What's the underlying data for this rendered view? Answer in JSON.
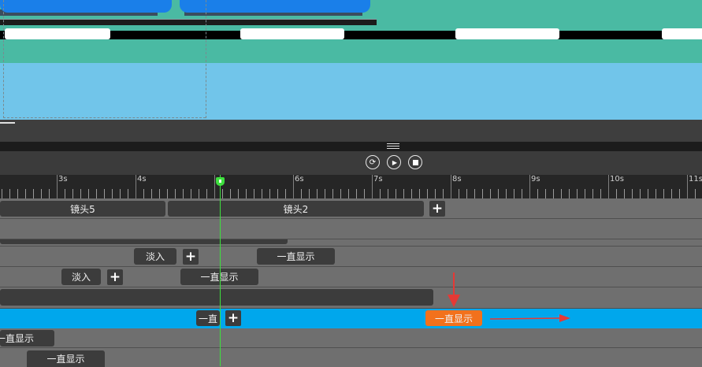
{
  "ruler": {
    "ticks": [
      "3s",
      "4s",
      "5s",
      "6s",
      "7s",
      "8s",
      "9s",
      "10s",
      "11s"
    ]
  },
  "playback": {
    "refresh_icon": "refresh-icon",
    "play_icon": "play-icon",
    "stop_icon": "stop-icon"
  },
  "tracks": {
    "shots": [
      {
        "label": "镜头5"
      },
      {
        "label": "镜头2"
      }
    ],
    "fade_in_1": "淡入",
    "always_show_1": "一直显示",
    "fade_in_2": "淡入",
    "always_show_2": "一直显示",
    "selected_clip_truncated": "一直",
    "selected_always_show": "一直显示",
    "always_show_3": "一直显示",
    "always_show_4": "一直显示"
  },
  "colors": {
    "selected_track": "#00a7ec",
    "selected_clip": "#f2711c",
    "playhead": "#3ee03e",
    "annotation": "#e53935"
  }
}
